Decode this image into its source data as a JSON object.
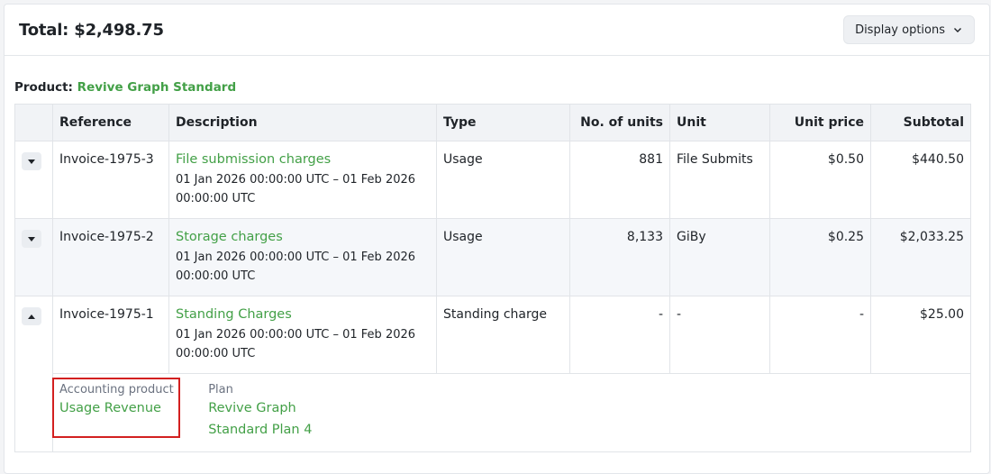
{
  "header": {
    "total": "Total: $2,498.75",
    "display_options": "Display options"
  },
  "product": {
    "label": "Product:",
    "name": "Revive Graph Standard"
  },
  "table": {
    "columns": [
      "Reference",
      "Description",
      "Type",
      "No. of units",
      "Unit",
      "Unit price",
      "Subtotal"
    ],
    "rows": [
      {
        "reference": "Invoice-1975-3",
        "description": "File submission charges",
        "period": "01 Jan 2026 00:00:00 UTC – 01 Feb 2026 00:00:00 UTC",
        "type": "Usage",
        "units": "881",
        "unit": "File Submits",
        "unit_price": "$0.50",
        "subtotal": "$440.50",
        "expanded": false
      },
      {
        "reference": "Invoice-1975-2",
        "description": "Storage charges",
        "period": "01 Jan 2026 00:00:00 UTC – 01 Feb 2026 00:00:00 UTC",
        "type": "Usage",
        "units": "8,133",
        "unit": "GiBy",
        "unit_price": "$0.25",
        "subtotal": "$2,033.25",
        "expanded": false
      },
      {
        "reference": "Invoice-1975-1",
        "description": "Standing Charges",
        "period": "01 Jan 2026 00:00:00 UTC – 01 Feb 2026 00:00:00 UTC",
        "type": "Standing charge",
        "units": "-",
        "unit": "-",
        "unit_price": "-",
        "subtotal": "$25.00",
        "expanded": true
      }
    ],
    "detail": {
      "accounting_product_label": "Accounting product",
      "accounting_product_value": "Usage Revenue",
      "plan_label": "Plan",
      "plan_value_line1": "Revive Graph",
      "plan_value_line2": "Standard Plan 4"
    }
  },
  "colors": {
    "link_green": "#43a047",
    "highlight_red": "#d32020"
  }
}
